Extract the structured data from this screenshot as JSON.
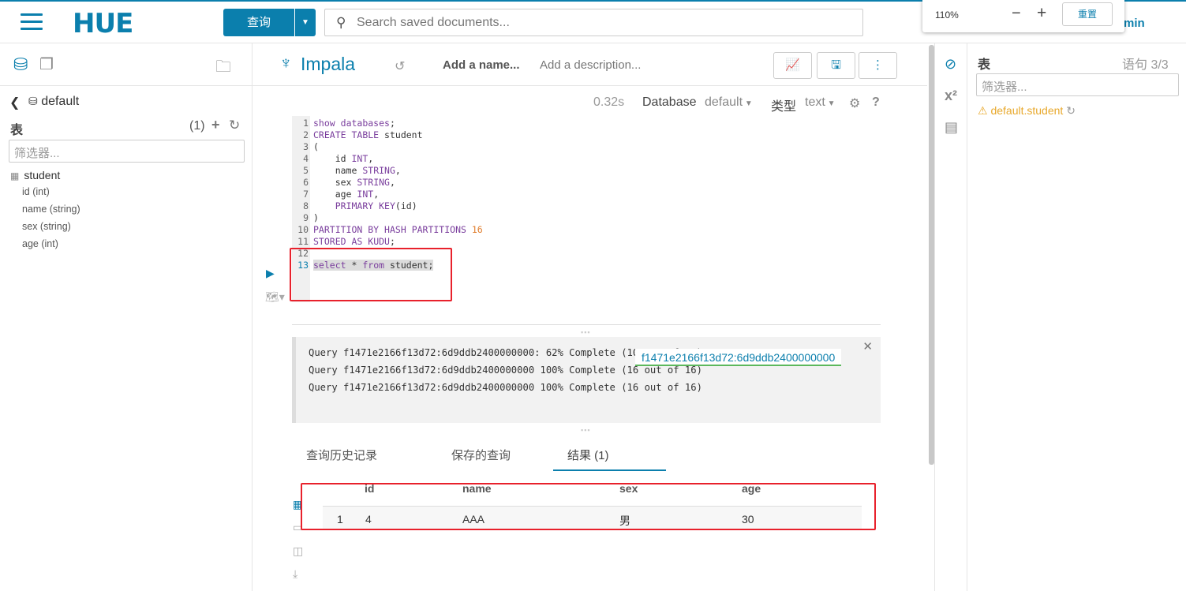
{
  "topbar": {
    "logo": "HUE",
    "query_button": "查询",
    "search_placeholder": "Search saved documents...",
    "zoom_level": "110%",
    "zoom_minus": "−",
    "zoom_plus": "+",
    "zoom_reset": "重置",
    "user": "min"
  },
  "left": {
    "database": "default",
    "tables_header": "表",
    "tables_count": "(1)",
    "filter_placeholder": "筛选器...",
    "table": "student",
    "columns": [
      "id (int)",
      "name (string)",
      "sex (string)",
      "age (int)"
    ]
  },
  "editor": {
    "engine": "Impala",
    "name_placeholder": "Add a name...",
    "description_placeholder": "Add a description...",
    "exec_time": "0.32s",
    "database_label": "Database",
    "database_value": "default",
    "type_label": "类型",
    "type_value": "text",
    "code_lines": [
      "show databases;",
      "CREATE TABLE student",
      "(",
      "    id INT,",
      "    name STRING,",
      "    sex STRING,",
      "    age INT,",
      "    PRIMARY KEY(id)",
      ")",
      "PARTITION BY HASH PARTITIONS 16",
      "STORED AS KUDU;",
      "",
      "select * from student;"
    ]
  },
  "log": {
    "lines": [
      "Query f1471e2166f13d72:6d9ddb2400000000: 62% Complete (10 out of 16)",
      "Query f1471e2166f13d72:6d9ddb2400000000 100% Complete (16 out of 16)",
      "Query f1471e2166f13d72:6d9ddb2400000000 100% Complete (16 out of 16)"
    ],
    "query_id_tooltip": "f1471e2166f13d72:6d9ddb2400000000"
  },
  "tabs": [
    "查询历史记录",
    "保存的查询",
    "结果 (1)"
  ],
  "results": {
    "headers": [
      "id",
      "name",
      "sex",
      "age"
    ],
    "rows": [
      [
        "1",
        "4",
        "AAA",
        "男",
        "30"
      ]
    ]
  },
  "right": {
    "title": "表",
    "statement_count": "语句 3/3",
    "filter_placeholder": "筛选器...",
    "warning_table": "default.student"
  },
  "colors": {
    "accent": "#0B7FAD",
    "highlight_box": "#e8212c",
    "warning": "#E8A82B"
  }
}
